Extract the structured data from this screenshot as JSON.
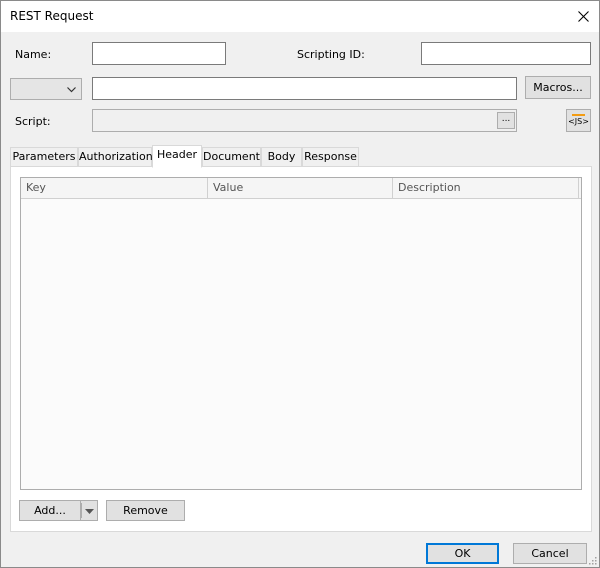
{
  "window": {
    "title": "REST Request"
  },
  "form": {
    "name_label": "Name:",
    "name_value": "",
    "scripting_id_label": "Scripting ID:",
    "scripting_id_value": "",
    "method_value": "",
    "url_value": "",
    "macros_label": "Macros...",
    "script_label": "Script:",
    "script_value": "",
    "ellipsis_label": "...",
    "js_label": "<JS>"
  },
  "tabs": [
    {
      "label": "Parameters",
      "active": false
    },
    {
      "label": "Authorization",
      "active": false
    },
    {
      "label": "Header",
      "active": true
    },
    {
      "label": "Document",
      "active": false
    },
    {
      "label": "Body",
      "active": false
    },
    {
      "label": "Response",
      "active": false
    }
  ],
  "grid": {
    "columns": [
      "Key",
      "Value",
      "Description"
    ],
    "rows": []
  },
  "actions": {
    "add_label": "Add...",
    "remove_label": "Remove"
  },
  "footer": {
    "ok_label": "OK",
    "cancel_label": "Cancel"
  },
  "colors": {
    "accent": "#0078d7",
    "js_bar": "#f39c12",
    "dialog_bg": "#f0f0f0"
  }
}
